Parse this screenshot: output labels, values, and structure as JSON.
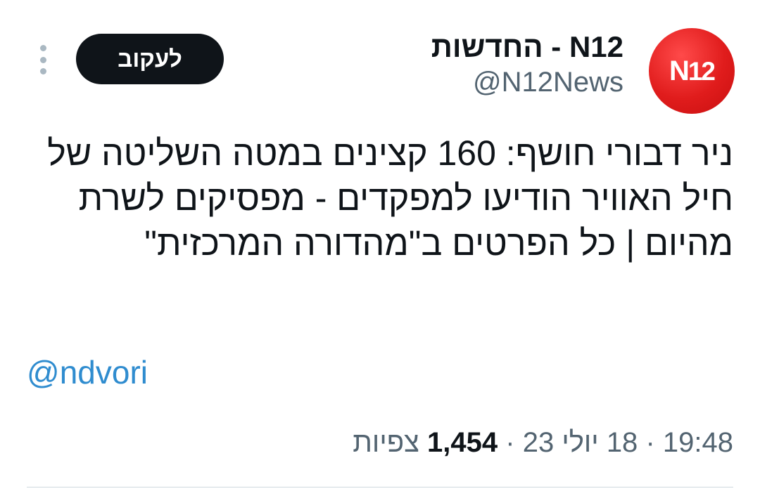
{
  "author": {
    "avatar_logo_letters": "N",
    "avatar_logo_number": "12",
    "display_name": "החדשות - N12",
    "handle": "@N12News"
  },
  "actions": {
    "follow_label": "לעקוב",
    "more_icon": "more-vertical-icon"
  },
  "tweet": {
    "text": "ניר דבורי חושף: 160 קצינים במטה השליטה של חיל האוויר הודיעו למפקדים - מפסיקים לשרת מהיום | כל הפרטים ב\"מהדורה המרכזית\"",
    "mention": "@ndvori"
  },
  "meta": {
    "time": "19:48",
    "separator": "·",
    "date": "18 יולי 23",
    "views_count": "1,454",
    "views_label": "צפיות"
  },
  "colors": {
    "brand_red": "#e01c1c",
    "link_blue": "#2f8ccf",
    "follow_button_bg": "#0f1419",
    "secondary_text": "#536471"
  }
}
